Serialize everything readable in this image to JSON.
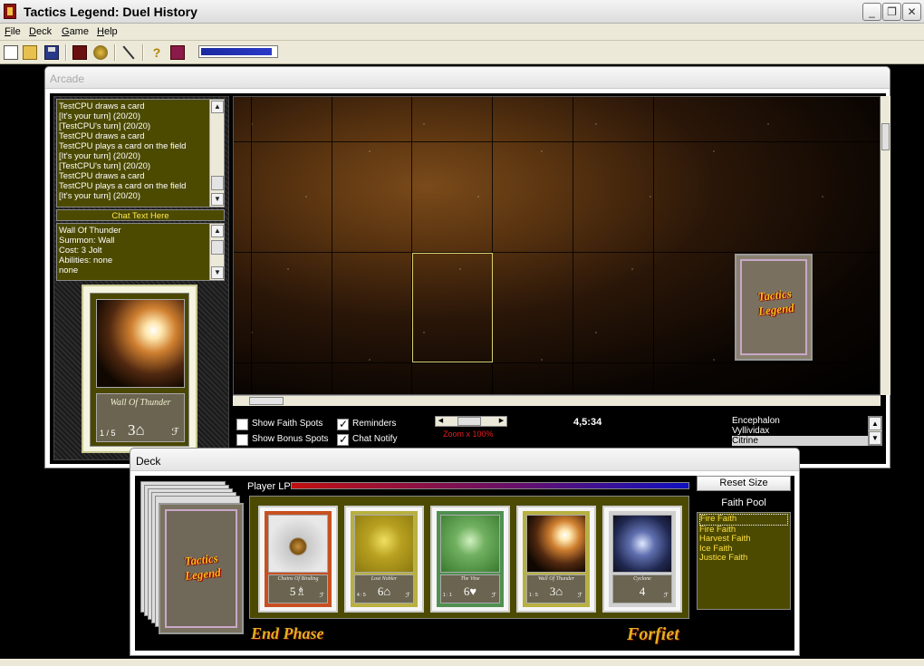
{
  "window": {
    "title": "Tactics Legend: Duel History",
    "min": "_",
    "max": "❐",
    "close": "✕"
  },
  "menu": {
    "file": "File",
    "deck": "Deck",
    "game": "Game",
    "help": "Help"
  },
  "toolbar": {
    "progress_fraction": 0.95,
    "help_glyph": "?"
  },
  "arcade": {
    "title": "Arcade",
    "log": [
      "TestCPU draws a card",
      "[It's your turn] (20/20)",
      "[TestCPU's turn] (20/20)",
      "TestCPU draws a card",
      "TestCPU plays a card on the field",
      "[It's your turn] (20/20)",
      "[TestCPU's turn] (20/20)",
      "TestCPU draws a card",
      "TestCPU plays a card on the field",
      "[It's your turn] (20/20)"
    ],
    "chat_placeholder": "Chat Text Here",
    "info": [
      "Wall Of Thunder",
      "Summon: Wall",
      "Cost: 3 Jolt",
      "Abilities: none",
      "none"
    ],
    "preview_card": {
      "name": "Wall Of Thunder",
      "count": "1 / 5",
      "cost": "3⌂",
      "glyph": "ℱ"
    },
    "field_card_logo": "Tactics Legend",
    "options": {
      "show_faith_spots": "Show Faith Spots",
      "show_bonus_spots": "Show Bonus Spots",
      "reminders": "Reminders",
      "chat_notify": "Chat Notify"
    },
    "zoom": "Zoom x 100%",
    "coordinates": "4,5:34",
    "decks": [
      "Encephalon",
      "Vyllividax",
      "Citrine"
    ]
  },
  "deck": {
    "title": "Deck",
    "lp_label": "Player LP",
    "reset_size": "Reset Size",
    "pile_logo": "Tactics Legend",
    "hand": [
      {
        "name": "Chains Of Binding",
        "cost": "5♗",
        "count": "",
        "glyph": "ℱ",
        "art": "chains"
      },
      {
        "name": "Lost Nobler",
        "cost": "6⌂",
        "count": "4 : 5",
        "glyph": "ℱ",
        "art": "gold"
      },
      {
        "name": "The Vine",
        "cost": "6♥",
        "count": "1 : 1",
        "glyph": "ℱ",
        "art": "green"
      },
      {
        "name": "Wall Of Thunder",
        "cost": "3⌂",
        "count": "1 : 5",
        "glyph": "ℱ",
        "art": "fire"
      },
      {
        "name": "Cyclone",
        "cost": "4",
        "count": "",
        "glyph": "ℱ",
        "art": "storm"
      }
    ],
    "end_phase": "End Phase",
    "forfeit": "Forfiet",
    "faith_pool_title": "Faith Pool",
    "faith_pool": [
      "Fire Faith",
      "Fire Faith",
      "Harvest Faith",
      "Ice Faith",
      "Justice Faith"
    ]
  }
}
